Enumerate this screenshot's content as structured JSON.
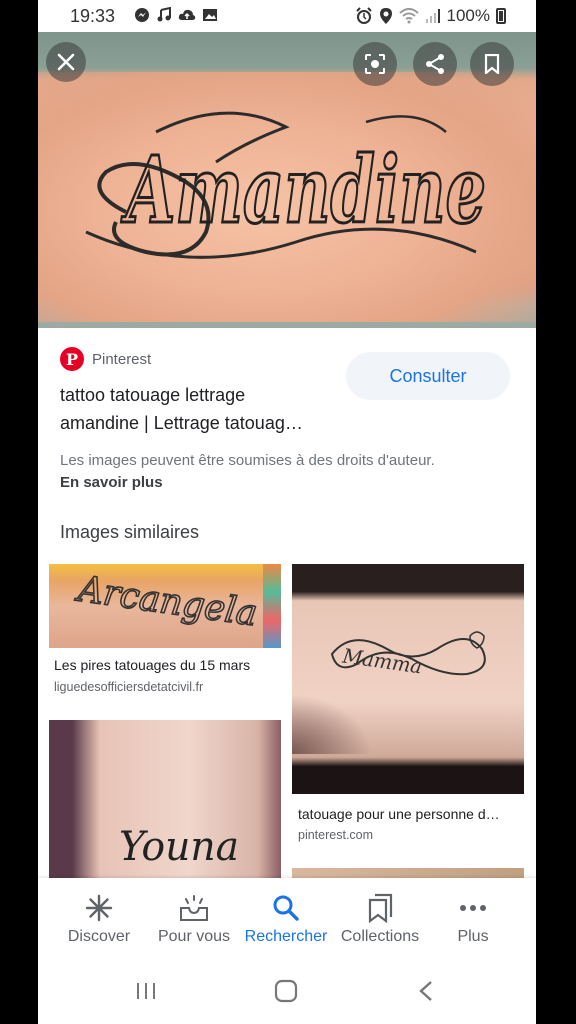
{
  "status_bar": {
    "time": "19:33",
    "battery": "100%",
    "icons": [
      "messenger-icon",
      "music-icon",
      "cloud-upload-icon",
      "image-icon",
      "alarm-icon",
      "location-icon",
      "wifi-icon",
      "signal-icon",
      "battery-icon"
    ]
  },
  "hero": {
    "tattoo_text": "Amandine",
    "buttons": [
      "close-icon",
      "lens-icon",
      "share-icon",
      "bookmark-icon"
    ]
  },
  "result": {
    "source": "Pinterest",
    "title_line1": "tattoo tatouage lettrage",
    "title_line2": "amandine | Lettrage tatouag…",
    "consult_label": "Consulter",
    "copyright_notice": "Les images peuvent être soumises à des droits d'auteur.",
    "learn_more": "En savoir plus"
  },
  "similar": {
    "heading": "Images similaires",
    "items": [
      {
        "title": "Les pires tatouages du 15 mars",
        "domain": "liguedesofficiersdetatcivil.fr",
        "tattoo_text": "Arcangela"
      },
      {
        "title": "tatouage pour une personne d…",
        "domain": "pinterest.com",
        "tattoo_text": "Mamma"
      },
      {
        "title": "",
        "domain": "",
        "tattoo_text": "Youna"
      }
    ]
  },
  "bottom_nav": {
    "items": [
      {
        "label": "Discover",
        "icon": "asterisk-icon"
      },
      {
        "label": "Pour vous",
        "icon": "inbox-icon"
      },
      {
        "label": "Rechercher",
        "icon": "search-icon",
        "active": true
      },
      {
        "label": "Collections",
        "icon": "collections-icon"
      },
      {
        "label": "Plus",
        "icon": "more-icon"
      }
    ]
  },
  "colors": {
    "accent": "#1a73e8",
    "pinterest": "#e60023"
  }
}
